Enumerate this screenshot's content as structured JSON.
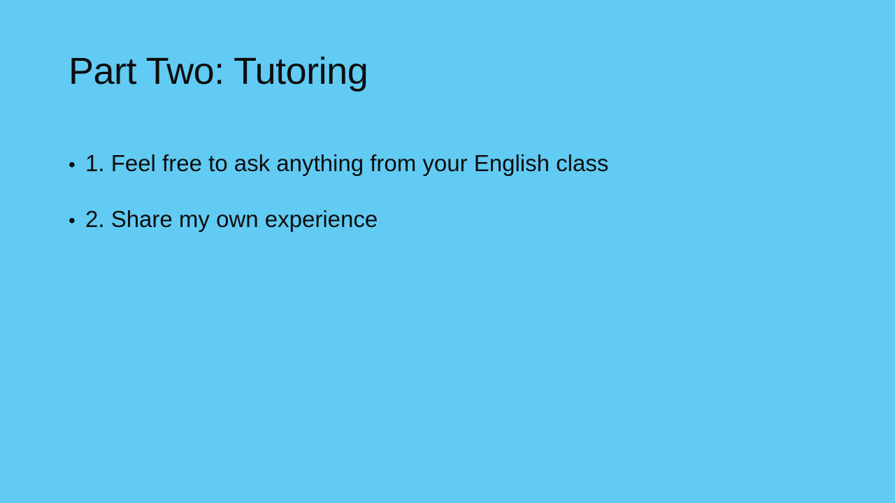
{
  "slide": {
    "title": "Part Two: Tutoring",
    "bullets": [
      {
        "marker": "•",
        "text": "1. Feel free to ask anything from your English class"
      },
      {
        "marker": "•",
        "text": "2. Share my own experience"
      }
    ]
  },
  "colors": {
    "background": "#61CBF4",
    "text": "#0d0d0d"
  }
}
